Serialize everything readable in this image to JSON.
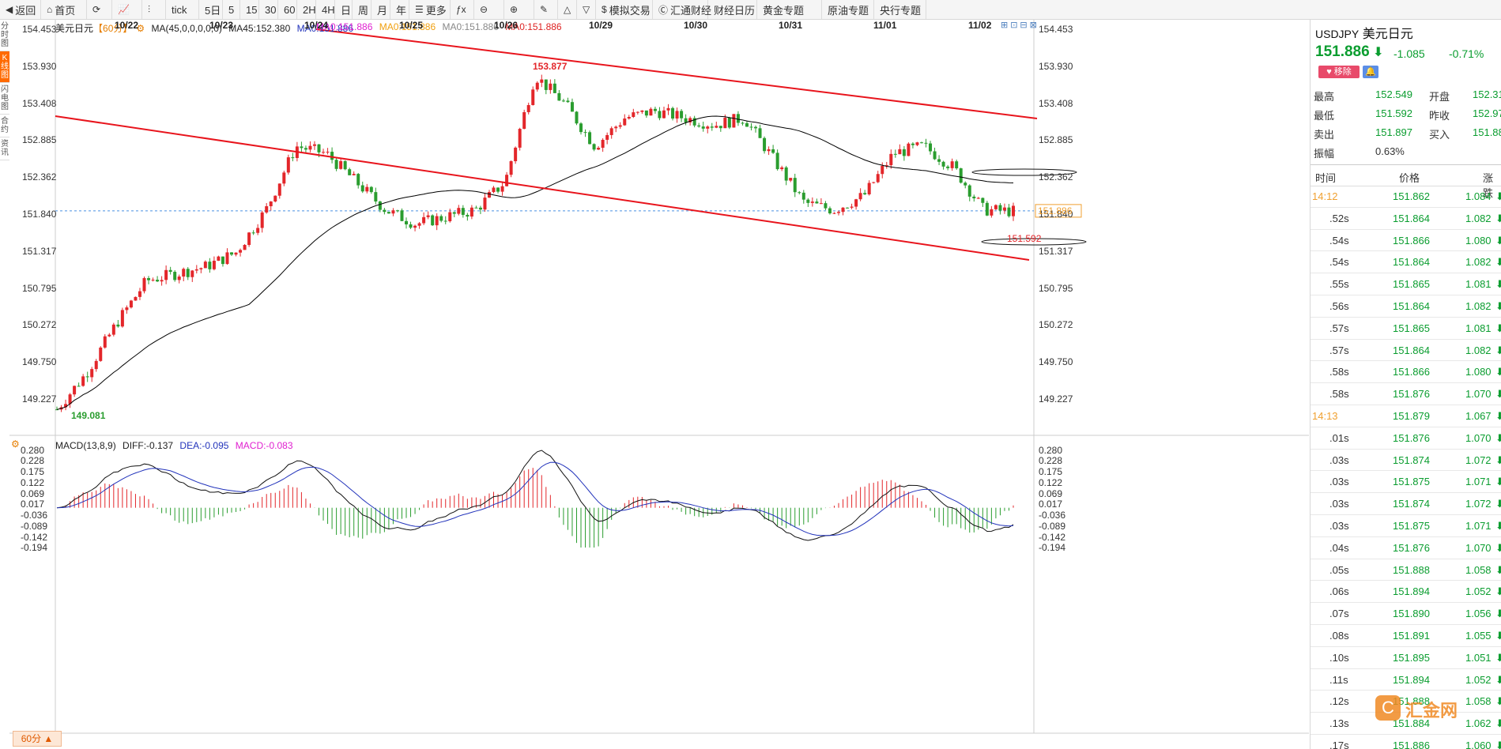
{
  "toolbar": [
    {
      "icon": "arrow-left-icon",
      "glyph": "◀",
      "label": "返回"
    },
    {
      "icon": "home-icon",
      "glyph": "⌂",
      "label": "首页"
    },
    {
      "icon": "refresh-icon",
      "glyph": "⟳",
      "label": ""
    },
    {
      "icon": "chart-type-icon",
      "glyph": "📈",
      "label": ""
    },
    {
      "icon": "candles-icon",
      "glyph": "⫶",
      "label": ""
    },
    {
      "icon": "",
      "glyph": "",
      "label": "tick"
    },
    {
      "icon": "",
      "glyph": "",
      "label": "5日"
    },
    {
      "icon": "",
      "glyph": "",
      "label": "5"
    },
    {
      "icon": "",
      "glyph": "",
      "label": "15"
    },
    {
      "icon": "",
      "glyph": "",
      "label": "30"
    },
    {
      "icon": "",
      "glyph": "",
      "label": "60"
    },
    {
      "icon": "",
      "glyph": "",
      "label": "2H"
    },
    {
      "icon": "",
      "glyph": "",
      "label": "4H"
    },
    {
      "icon": "",
      "glyph": "",
      "label": "日"
    },
    {
      "icon": "",
      "glyph": "",
      "label": "周"
    },
    {
      "icon": "",
      "glyph": "",
      "label": "月"
    },
    {
      "icon": "",
      "glyph": "",
      "label": "年"
    },
    {
      "icon": "menu-icon",
      "glyph": "☰",
      "label": "更多"
    },
    {
      "icon": "formula-icon",
      "glyph": "ƒx",
      "label": ""
    },
    {
      "icon": "zoom-out-icon",
      "glyph": "⊖",
      "label": ""
    },
    {
      "icon": "zoom-in-icon",
      "glyph": "⊕",
      "label": ""
    },
    {
      "icon": "pen-icon",
      "glyph": "✎",
      "label": ""
    },
    {
      "icon": "triangle-up-icon",
      "glyph": "△",
      "label": ""
    },
    {
      "icon": "triangle-down-icon",
      "glyph": "▽",
      "label": ""
    },
    {
      "icon": "dollar-icon",
      "glyph": "$",
      "label": "模拟交易"
    },
    {
      "icon": "hui-icon",
      "glyph": "Ⓒ",
      "label": "汇通财经"
    },
    {
      "icon": "",
      "glyph": "",
      "label": "财经日历"
    },
    {
      "icon": "",
      "glyph": "",
      "label": "黄金专题"
    },
    {
      "icon": "",
      "glyph": "",
      "label": "原油专题"
    },
    {
      "icon": "",
      "glyph": "",
      "label": "央行专题"
    }
  ],
  "left_tabs": [
    "分时图",
    "K线图",
    "闪电图",
    "合约",
    "资讯"
  ],
  "legend": {
    "symbol": "美元日元",
    "period": "【60分】",
    "ma_main": "MA(45,0,0,0,0,0)",
    "ma45": "MA45:152.380",
    "ma_a": "MA0:151.886",
    "ma_b": "MA0:151.886",
    "ma_c": "MA0:151.886",
    "ma_d": "MA0:151.886",
    "ma_e": "MA0:151.886"
  },
  "macd_legend": {
    "name": "MACD(13,8,9)",
    "diff": "DIFF:-0.137",
    "dea": "DEA:-0.095",
    "macd": "MACD:-0.083"
  },
  "price_axis": [
    "154.453",
    "153.930",
    "153.408",
    "152.885",
    "152.362",
    "151.840",
    "151.317",
    "150.795",
    "150.272",
    "149.750",
    "149.227"
  ],
  "macd_axis": [
    "0.280",
    "0.228",
    "0.175",
    "0.122",
    "0.069",
    "0.017",
    "-0.036",
    "-0.089",
    "-0.142",
    "-0.194"
  ],
  "x_axis": [
    "10/22",
    "10/23",
    "10/24",
    "10/25",
    "10/26",
    "10/29",
    "10/30",
    "10/31",
    "11/01",
    "11/02"
  ],
  "annotations": {
    "high": "153.877",
    "low": "149.081",
    "last_price": "151.886",
    "channel_low": "151.592"
  },
  "period_badge": "60分 ▲",
  "colors": {
    "up": "#e3262a",
    "down": "#2a9d2f",
    "ma": "#000000",
    "channel": "#e8141c",
    "dea": "#2233bb",
    "macd_label": "#e020d0"
  },
  "chart_data": {
    "type": "candlestick",
    "title": "美元日元【60分】",
    "x": [
      "10/22",
      "10/23",
      "10/24",
      "10/25",
      "10/26",
      "10/29",
      "10/30",
      "10/31",
      "11/01",
      "11/02"
    ],
    "ylim": [
      149.081,
      154.453
    ],
    "high": 153.877,
    "low": 149.081,
    "last": 151.886,
    "ma45": 152.38,
    "close_approx": [
      149.08,
      149.6,
      150.3,
      150.9,
      151.0,
      151.1,
      151.3,
      151.9,
      152.8,
      152.7,
      152.3,
      151.9,
      151.7,
      151.8,
      151.9,
      152.3,
      153.8,
      153.4,
      152.8,
      153.2,
      153.3,
      153.2,
      153.1,
      153.2,
      152.6,
      152.0,
      151.9,
      152.1,
      152.7,
      152.8,
      152.5,
      151.9,
      151.88
    ],
    "macd": {
      "diff": -0.137,
      "dea": -0.095,
      "macd": -0.083,
      "ylim": [
        -0.194,
        0.28
      ]
    }
  },
  "quote": {
    "symbol": "USDJPY",
    "name": "美元日元",
    "price": "151.886",
    "change": "-1.085",
    "pct": "-0.71%",
    "btn_remove": "♥ 移除",
    "btn_alert": "🔔",
    "stats": [
      [
        "最高",
        "152.549",
        "开盘",
        "152.318"
      ],
      [
        "最低",
        "151.592",
        "昨收",
        "152.971"
      ],
      [
        "卖出",
        "151.897",
        "买入",
        "151.886"
      ],
      [
        "振幅",
        "0.63%",
        "",
        ""
      ]
    ],
    "tick_header": [
      "时间",
      "价格",
      "涨跌"
    ],
    "ticks": [
      {
        "t": "14:12",
        "p": "151.862",
        "c": "1.084"
      },
      {
        "t": ".52s",
        "p": "151.864",
        "c": "1.082"
      },
      {
        "t": ".54s",
        "p": "151.866",
        "c": "1.080"
      },
      {
        "t": ".54s",
        "p": "151.864",
        "c": "1.082"
      },
      {
        "t": ".55s",
        "p": "151.865",
        "c": "1.081"
      },
      {
        "t": ".56s",
        "p": "151.864",
        "c": "1.082"
      },
      {
        "t": ".57s",
        "p": "151.865",
        "c": "1.081"
      },
      {
        "t": ".57s",
        "p": "151.864",
        "c": "1.082"
      },
      {
        "t": ".58s",
        "p": "151.866",
        "c": "1.080"
      },
      {
        "t": ".58s",
        "p": "151.876",
        "c": "1.070"
      },
      {
        "t": "14:13",
        "p": "151.879",
        "c": "1.067"
      },
      {
        "t": ".01s",
        "p": "151.876",
        "c": "1.070"
      },
      {
        "t": ".03s",
        "p": "151.874",
        "c": "1.072"
      },
      {
        "t": ".03s",
        "p": "151.875",
        "c": "1.071"
      },
      {
        "t": ".03s",
        "p": "151.874",
        "c": "1.072"
      },
      {
        "t": ".03s",
        "p": "151.875",
        "c": "1.071"
      },
      {
        "t": ".04s",
        "p": "151.876",
        "c": "1.070"
      },
      {
        "t": ".05s",
        "p": "151.888",
        "c": "1.058"
      },
      {
        "t": ".06s",
        "p": "151.894",
        "c": "1.052"
      },
      {
        "t": ".07s",
        "p": "151.890",
        "c": "1.056"
      },
      {
        "t": ".08s",
        "p": "151.891",
        "c": "1.055"
      },
      {
        "t": ".10s",
        "p": "151.895",
        "c": "1.051"
      },
      {
        "t": ".11s",
        "p": "151.894",
        "c": "1.052"
      },
      {
        "t": ".12s",
        "p": "151.888",
        "c": "1.058"
      },
      {
        "t": ".13s",
        "p": "151.884",
        "c": "1.062"
      },
      {
        "t": ".17s",
        "p": "151.886",
        "c": "1.060"
      }
    ]
  },
  "watermark": "汇金网"
}
